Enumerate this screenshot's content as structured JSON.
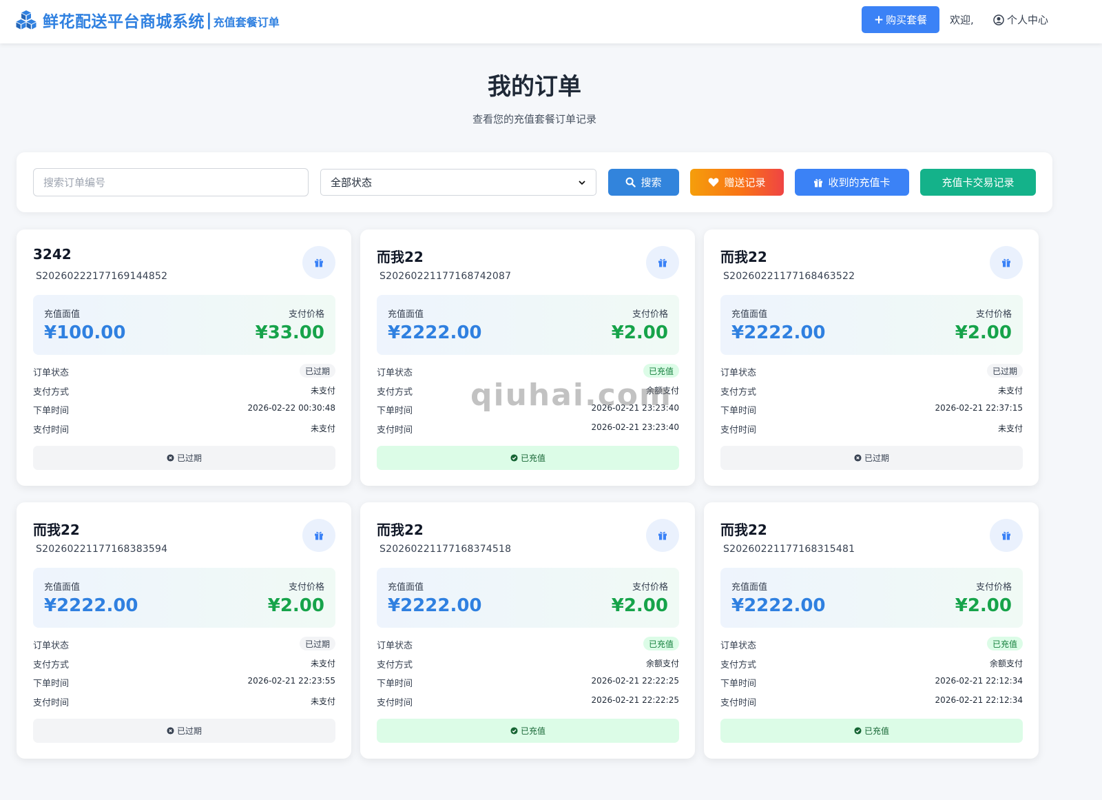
{
  "header": {
    "brand_title": "鲜花配送平台商城系统",
    "brand_separator": "|",
    "brand_subtitle": "充值套餐订单",
    "buy_button": "购买套餐",
    "welcome": "欢迎,",
    "user_center": "个人中心",
    "accent_color": "#2f80e0"
  },
  "page": {
    "title": "我的订单",
    "subtitle": "查看您的充值套餐订单记录"
  },
  "filters": {
    "search_placeholder": "搜索订单编号",
    "status_selected": "全部状态",
    "search_button": "搜索",
    "gift_record_button": "赠送记录",
    "received_cards_button": "收到的充值卡",
    "card_trade_button": "充值卡交易记录"
  },
  "labels": {
    "face_value": "充值面值",
    "pay_price": "支付价格",
    "order_status": "订单状态",
    "pay_method": "支付方式",
    "order_time": "下单时间",
    "pay_time": "支付时间"
  },
  "orders": [
    {
      "name": "3242",
      "order_no": "S20260222177169144852",
      "face_value": "¥100.00",
      "pay_price": "¥33.00",
      "status": "已过期",
      "pay_method": "未支付",
      "order_time": "2026-02-22 00:30:48",
      "pay_time": "未支付",
      "footer": "已过期"
    },
    {
      "name": "而我22",
      "order_no": "S20260221177168742087",
      "face_value": "¥2222.00",
      "pay_price": "¥2.00",
      "status": "已充值",
      "pay_method": "余额支付",
      "order_time": "2026-02-21 23:23:40",
      "pay_time": "2026-02-21 23:23:40",
      "footer": "已充值"
    },
    {
      "name": "而我22",
      "order_no": "S20260221177168463522",
      "face_value": "¥2222.00",
      "pay_price": "¥2.00",
      "status": "已过期",
      "pay_method": "未支付",
      "order_time": "2026-02-21 22:37:15",
      "pay_time": "未支付",
      "footer": "已过期"
    },
    {
      "name": "而我22",
      "order_no": "S20260221177168383594",
      "face_value": "¥2222.00",
      "pay_price": "¥2.00",
      "status": "已过期",
      "pay_method": "未支付",
      "order_time": "2026-02-21 22:23:55",
      "pay_time": "未支付",
      "footer": "已过期"
    },
    {
      "name": "而我22",
      "order_no": "S20260221177168374518",
      "face_value": "¥2222.00",
      "pay_price": "¥2.00",
      "status": "已充值",
      "pay_method": "余额支付",
      "order_time": "2026-02-21 22:22:25",
      "pay_time": "2026-02-21 22:22:25",
      "footer": "已充值"
    },
    {
      "name": "而我22",
      "order_no": "S20260221177168315481",
      "face_value": "¥2222.00",
      "pay_price": "¥2.00",
      "status": "已充值",
      "pay_method": "余额支付",
      "order_time": "2026-02-21 22:12:34",
      "pay_time": "2026-02-21 22:12:34",
      "footer": "已充值"
    }
  ],
  "watermark": "qiuhai.com"
}
